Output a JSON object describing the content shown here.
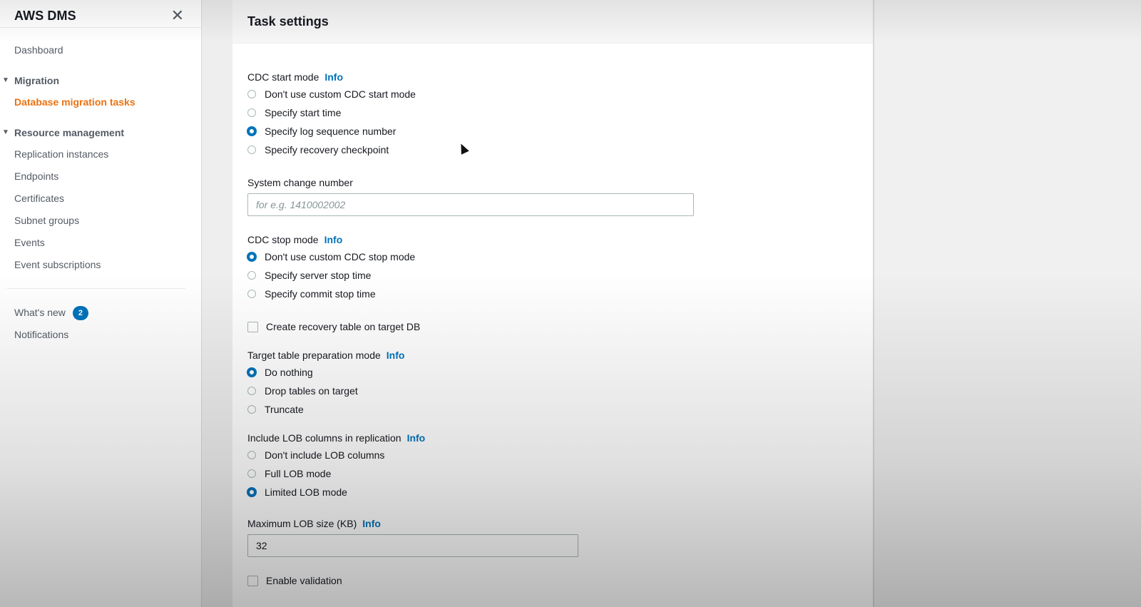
{
  "sidebar": {
    "title": "AWS DMS",
    "close_icon": "close-icon",
    "dashboard": "Dashboard",
    "sections": [
      {
        "label": "Migration",
        "items": [
          {
            "label": "Database migration tasks",
            "active": true
          }
        ]
      },
      {
        "label": "Resource management",
        "items": [
          {
            "label": "Replication instances"
          },
          {
            "label": "Endpoints"
          },
          {
            "label": "Certificates"
          },
          {
            "label": "Subnet groups"
          },
          {
            "label": "Events"
          },
          {
            "label": "Event subscriptions"
          }
        ]
      }
    ],
    "whats_new": "What's new",
    "whats_new_count": "2",
    "notifications": "Notifications"
  },
  "card": {
    "title": "Task settings",
    "info_label": "Info",
    "cdc_start_mode": {
      "label": "CDC start mode",
      "options": [
        "Don't use custom CDC start mode",
        "Specify start time",
        "Specify log sequence number",
        "Specify recovery checkpoint"
      ],
      "selected": "Specify log sequence number"
    },
    "system_change_number": {
      "label": "System change number",
      "placeholder": "for e.g. 1410002002",
      "value": ""
    },
    "cdc_stop_mode": {
      "label": "CDC stop mode",
      "options": [
        "Don't use custom CDC stop mode",
        "Specify server stop time",
        "Specify commit stop time"
      ],
      "selected": "Don't use custom CDC stop mode"
    },
    "create_recovery_table": {
      "label": "Create recovery table on target DB",
      "checked": false
    },
    "target_table_prep": {
      "label": "Target table preparation mode",
      "options": [
        "Do nothing",
        "Drop tables on target",
        "Truncate"
      ],
      "selected": "Do nothing"
    },
    "lob_columns": {
      "label": "Include LOB columns in replication",
      "options": [
        "Don't include LOB columns",
        "Full LOB mode",
        "Limited LOB mode"
      ],
      "selected": "Limited LOB mode"
    },
    "max_lob_size": {
      "label": "Maximum LOB size (KB)",
      "value": "32"
    },
    "enable_validation": {
      "label": "Enable validation",
      "checked": false
    }
  },
  "colors": {
    "accent": "#0073bb",
    "active_nav": "#ec7211"
  }
}
